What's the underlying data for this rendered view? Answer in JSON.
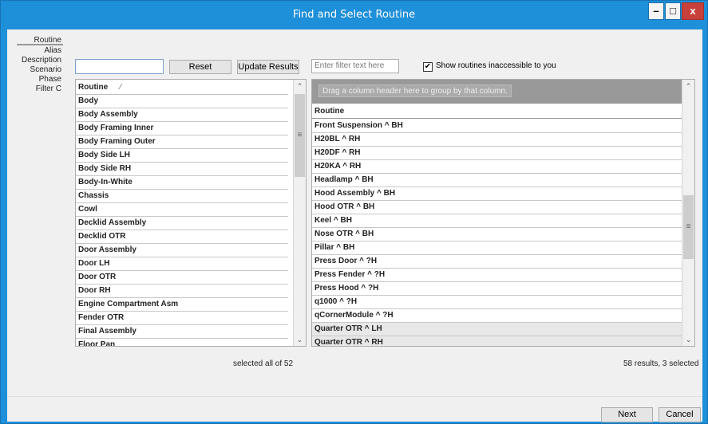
{
  "window": {
    "title": "Find and Select Routine",
    "min_glyph": "–",
    "max_glyph": "□",
    "close_glyph": "x"
  },
  "sidenav": [
    "Routine",
    "Alias",
    "Description",
    "Scenario",
    "Phase",
    "Filter C"
  ],
  "search": {
    "value": "",
    "placeholder": ""
  },
  "buttons": {
    "reset": "Reset",
    "update": "Update Results",
    "next": "Next",
    "cancel": "Cancel"
  },
  "filter": {
    "placeholder": "Enter filter text here"
  },
  "checkbox": {
    "label": "Show routines inaccessible to you",
    "checked": true,
    "glyph": "✔"
  },
  "left_list": {
    "header": "Routine",
    "sort_glyph": "⁄",
    "items": [
      "Body",
      "Body Assembly",
      "Body Framing Inner",
      "Body Framing Outer",
      "Body Side LH",
      "Body Side RH",
      "Body-In-White",
      "Chassis",
      "Cowl",
      "Decklid Assembly",
      "Decklid OTR",
      "Door Assembly",
      "Door LH",
      "Door OTR",
      "Door RH",
      "Engine Compartment Asm",
      "Fender OTR",
      "Final Assembly",
      "Floor Pan"
    ],
    "status": "selected all of 52"
  },
  "right_grid": {
    "group_hint": "Drag a column header here to group by that column.",
    "header": "Routine",
    "rows": [
      "Front Suspension ^ BH",
      "H20BL ^ RH",
      "H20DF ^ RH",
      "H20KA ^ RH",
      "Headlamp ^ BH",
      "Hood Assembly ^ BH",
      "Hood OTR ^ BH",
      "Keel ^ BH",
      "Nose OTR ^ BH",
      "Pillar ^ BH",
      "Press Door ^ ?H",
      "Press Fender ^ ?H",
      "Press Hood ^ ?H",
      "q1000 ^ ?H",
      "qCornerModule ^ ?H",
      "Quarter OTR ^ LH",
      "Quarter OTR ^ RH"
    ],
    "selected_rows": [
      15,
      16
    ],
    "status": "58 results, 3 selected"
  },
  "scroll": {
    "up_glyph": "⌃",
    "down_glyph": "⌄",
    "grip_glyph": "≡"
  }
}
